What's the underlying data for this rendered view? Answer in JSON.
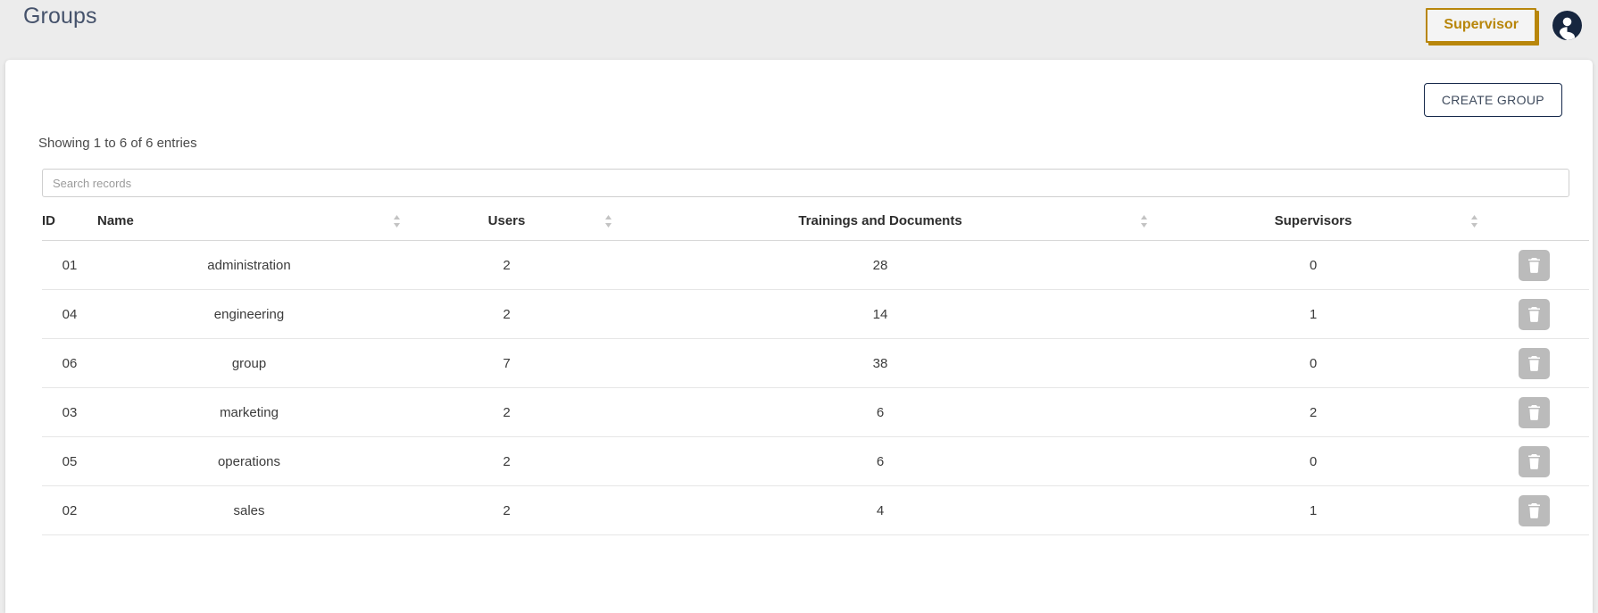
{
  "header": {
    "title": "Groups",
    "role_button_label": "Supervisor",
    "avatar_icon": "account-circle-icon",
    "accent_color": "#b8860b",
    "title_color": "#45526b"
  },
  "toolbar": {
    "create_group_label": "CREATE GROUP"
  },
  "table_info": {
    "entries_text": "Showing 1 to 6 of 6 entries"
  },
  "search": {
    "placeholder": "Search records",
    "value": ""
  },
  "table": {
    "columns": [
      {
        "label": "ID",
        "sortable": false
      },
      {
        "label": "Name",
        "sortable": true
      },
      {
        "label": "Users",
        "sortable": true
      },
      {
        "label": "Trainings and Documents",
        "sortable": true
      },
      {
        "label": "Supervisors",
        "sortable": true
      },
      {
        "label": "",
        "sortable": false
      }
    ],
    "rows": [
      {
        "id": "01",
        "name": "administration",
        "users": "2",
        "trainings": "28",
        "supervisors": "0",
        "delete_icon": "trash-icon"
      },
      {
        "id": "04",
        "name": "engineering",
        "users": "2",
        "trainings": "14",
        "supervisors": "1",
        "delete_icon": "trash-icon"
      },
      {
        "id": "06",
        "name": "group",
        "users": "7",
        "trainings": "38",
        "supervisors": "0",
        "delete_icon": "trash-icon"
      },
      {
        "id": "03",
        "name": "marketing",
        "users": "2",
        "trainings": "6",
        "supervisors": "2",
        "delete_icon": "trash-icon"
      },
      {
        "id": "05",
        "name": "operations",
        "users": "2",
        "trainings": "6",
        "supervisors": "0",
        "delete_icon": "trash-icon"
      },
      {
        "id": "02",
        "name": "sales",
        "users": "2",
        "trainings": "4",
        "supervisors": "1",
        "delete_icon": "trash-icon"
      }
    ]
  }
}
